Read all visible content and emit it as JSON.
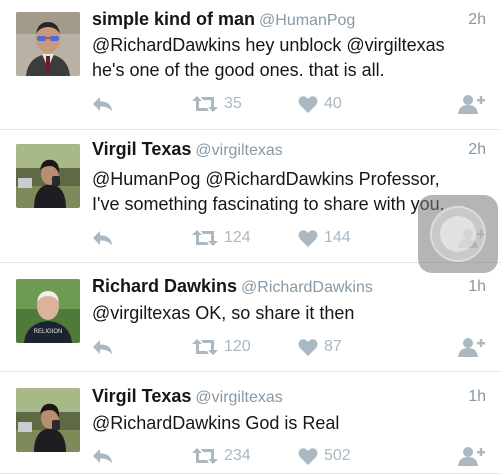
{
  "tweets": [
    {
      "name": "simple kind of man",
      "handle": "@HumanPog",
      "time": "2h",
      "text_lines": [
        "@RichardDawkins hey unblock @virgiltexas",
        "he's one of the good ones. that is all."
      ],
      "retweets": "35",
      "likes": "40"
    },
    {
      "name": "Virgil Texas",
      "handle": "@virgiltexas",
      "time": "2h",
      "text_lines": [
        "@HumanPog @RichardDawkins Professor,",
        "I've something fascinating to share with you."
      ],
      "retweets": "124",
      "likes": "144"
    },
    {
      "name": "Richard Dawkins",
      "handle": "@RichardDawkins",
      "time": "1h",
      "text_lines": [
        "@virgiltexas OK, so share it then"
      ],
      "retweets": "120",
      "likes": "87",
      "avatar_shirt_text": "RELIGION"
    },
    {
      "name": "Virgil Texas",
      "handle": "@virgiltexas",
      "time": "1h",
      "text_lines": [
        "@RichardDawkins God is Real"
      ],
      "retweets": "234",
      "likes": "502"
    }
  ],
  "icons": {
    "reply": "reply-icon",
    "retweet": "retweet-icon",
    "like": "heart-icon",
    "follow": "follow-icon"
  },
  "colors": {
    "text": "#14171a",
    "secondary": "#8899a6",
    "action": "#aab8c2",
    "divider": "#e1e8ed"
  }
}
